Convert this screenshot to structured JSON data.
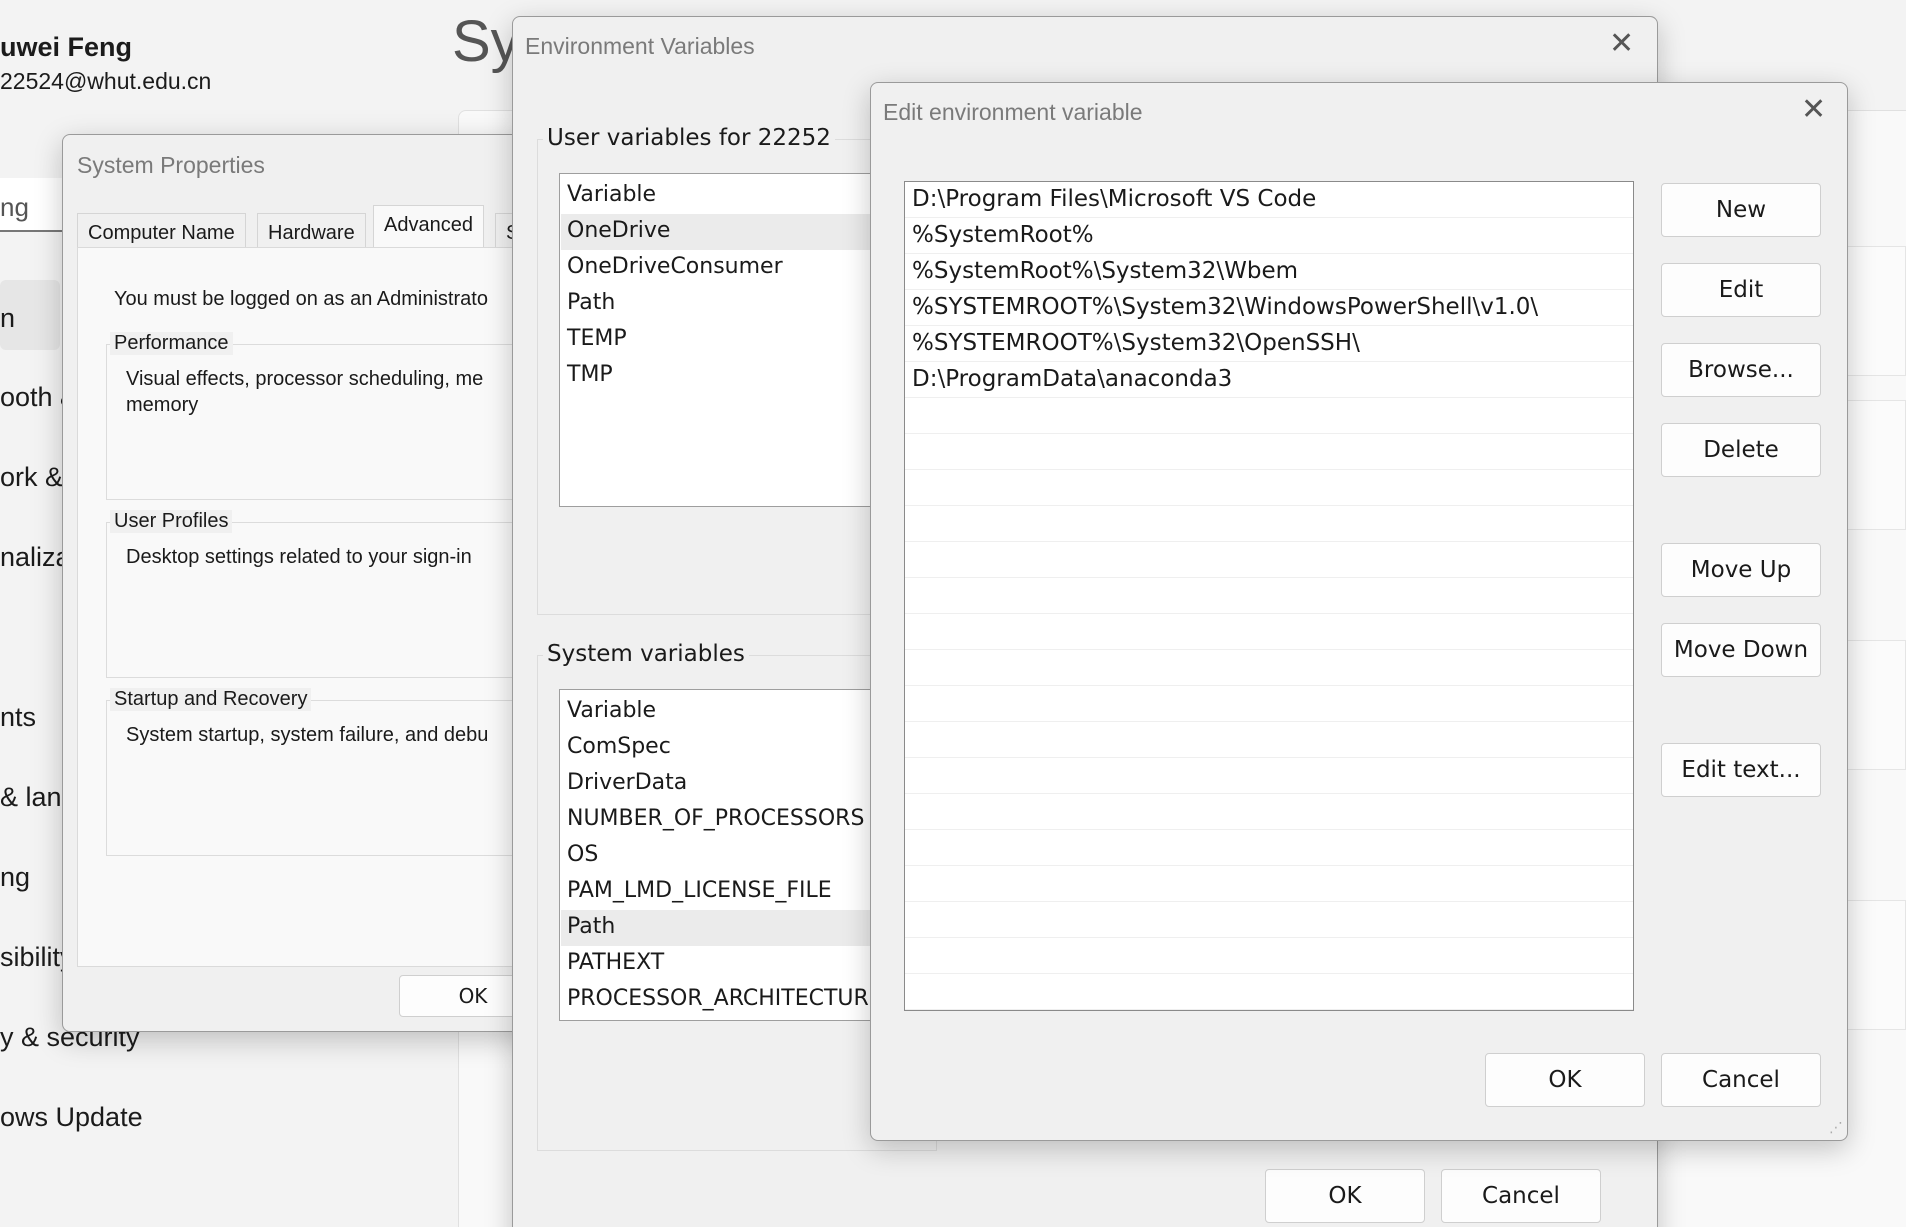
{
  "settings": {
    "title": "Sy",
    "user_name": "uwei Feng",
    "user_email": "22524@whut.edu.cn",
    "search_text": "ng",
    "nav": [
      "n",
      "ooth &",
      "ork &",
      "naliza",
      "nts",
      "& lang",
      "ng",
      "sibility",
      "y & security",
      "ows Update"
    ]
  },
  "system_properties": {
    "title": "System Properties",
    "tabs": [
      "Computer Name",
      "Hardware",
      "Advanced",
      "S"
    ],
    "admin_notice": "You must be logged on as an Administrato",
    "performance": {
      "label": "Performance",
      "text_line1": "Visual effects, processor scheduling, me",
      "text_line2": "memory"
    },
    "user_profiles": {
      "label": "User Profiles",
      "text": "Desktop settings related to your sign-in"
    },
    "startup": {
      "label": "Startup and Recovery",
      "text": "System startup, system failure, and debu"
    },
    "ok_label": "OK"
  },
  "env_vars": {
    "title": "Environment Variables",
    "user_section": "User variables for 22252",
    "user_header": "Variable",
    "user_rows": [
      "OneDrive",
      "OneDriveConsumer",
      "Path",
      "TEMP",
      "TMP"
    ],
    "system_section": "System variables",
    "system_header": "Variable",
    "system_rows": [
      "ComSpec",
      "DriverData",
      "NUMBER_OF_PROCESSORS",
      "OS",
      "PAM_LMD_LICENSE_FILE",
      "Path",
      "PATHEXT",
      "PROCESSOR_ARCHITECTURE"
    ],
    "ok_label": "OK",
    "cancel_label": "Cancel"
  },
  "edit_var": {
    "title": "Edit environment variable",
    "entries": [
      "D:\\Program Files\\Microsoft VS Code",
      "%SystemRoot%",
      "%SystemRoot%\\System32\\Wbem",
      "%SYSTEMROOT%\\System32\\WindowsPowerShell\\v1.0\\",
      "%SYSTEMROOT%\\System32\\OpenSSH\\",
      "D:\\ProgramData\\anaconda3"
    ],
    "buttons": {
      "new": "New",
      "edit": "Edit",
      "browse": "Browse...",
      "delete": "Delete",
      "move_up": "Move Up",
      "move_down": "Move Down",
      "edit_text": "Edit text...",
      "ok": "OK",
      "cancel": "Cancel"
    }
  },
  "icons": {
    "close": "close-icon",
    "resize": "resize-grip-icon"
  }
}
